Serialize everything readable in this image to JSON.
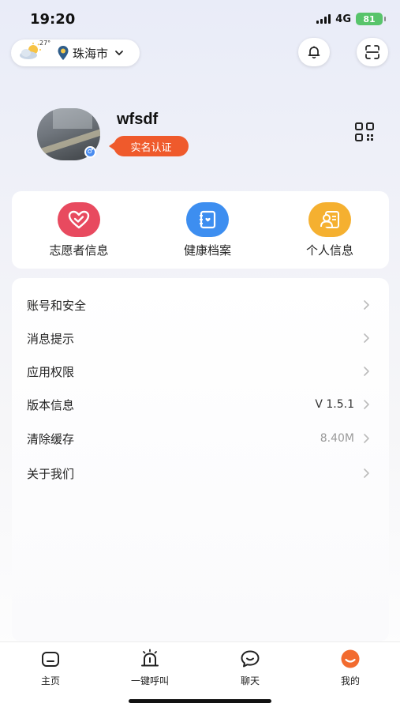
{
  "status_bar": {
    "time": "19:20",
    "network": "4G",
    "battery": "81"
  },
  "header": {
    "weather_temp": "27°",
    "city": "珠海市",
    "weather_icon": "partly-cloudy-icon",
    "location_icon": "map-pin-icon"
  },
  "profile": {
    "username": "wfsdf",
    "verify_label": "实名认证",
    "gender_symbol": "♂"
  },
  "quick_actions": [
    {
      "label": "志愿者信息",
      "icon": "heart-icon",
      "color": "#e84a5f"
    },
    {
      "label": "健康档案",
      "icon": "health-record-icon",
      "color": "#3d8ef0"
    },
    {
      "label": "个人信息",
      "icon": "id-card-icon",
      "color": "#f5b030"
    }
  ],
  "menu": [
    {
      "label": "账号和安全",
      "value": ""
    },
    {
      "label": "消息提示",
      "value": ""
    },
    {
      "label": "应用权限",
      "value": ""
    },
    {
      "label": "版本信息",
      "value": "V 1.5.1"
    },
    {
      "label": "清除缓存",
      "value": "8.40M"
    },
    {
      "label": "关于我们",
      "value": ""
    }
  ],
  "tabs": [
    {
      "label": "主页",
      "icon": "home-icon"
    },
    {
      "label": "一键呼叫",
      "icon": "alarm-icon"
    },
    {
      "label": "聊天",
      "icon": "chat-icon"
    },
    {
      "label": "我的",
      "icon": "profile-icon",
      "active_color": "#f26b2f"
    }
  ]
}
